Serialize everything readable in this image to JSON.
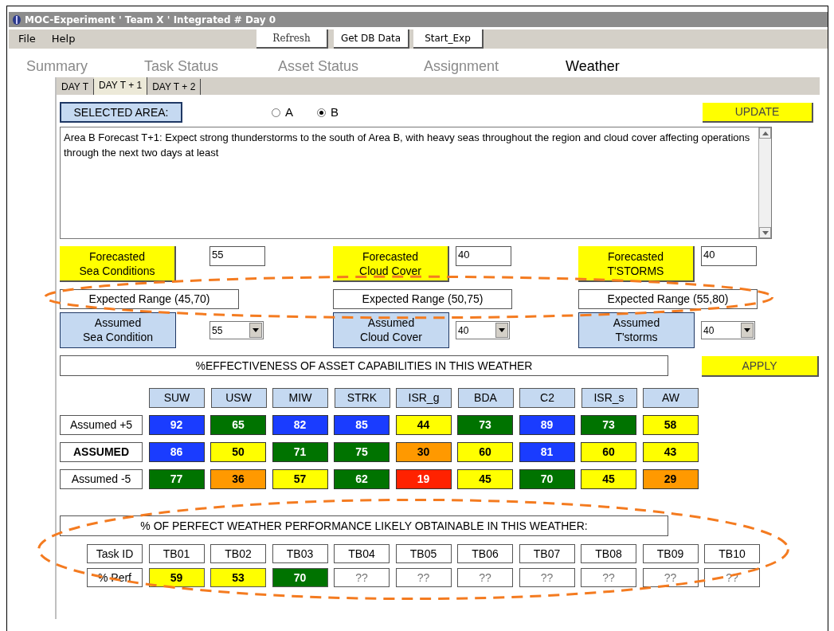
{
  "window": {
    "title": "MOC-Experiment ' Team X '  Integrated # Day 0"
  },
  "menu": [
    "File",
    "Help"
  ],
  "toolbar": {
    "buttons": [
      "Refresh",
      "Get DB Data",
      "Start_Exp"
    ]
  },
  "main_tabs": [
    {
      "label": "Summary",
      "selected": false
    },
    {
      "label": "Task Status",
      "selected": false
    },
    {
      "label": "Asset Status",
      "selected": false
    },
    {
      "label": "Assignment",
      "selected": false
    },
    {
      "label": "Weather",
      "selected": true
    }
  ],
  "day_tabs": [
    {
      "label": "DAY T",
      "selected": false
    },
    {
      "label": "DAY T + 1",
      "selected": true
    },
    {
      "label": "DAY T + 2",
      "selected": false
    }
  ],
  "selected_area": {
    "label": "SELECTED AREA:",
    "options": [
      {
        "label": "A",
        "selected": false
      },
      {
        "label": "B",
        "selected": true
      }
    ]
  },
  "update_button": "UPDATE",
  "forecast_text": "Area B Forecast T+1:  Expect strong thunderstorms to the south of Area B, with heavy seas throughout the region and cloud cover affecting operations through the next two days at least",
  "conditions": [
    {
      "forecast_label": "Forecasted\nSea Conditions",
      "forecast_value": "55",
      "range": "Expected Range (45,70)",
      "assumed_label": "Assumed\nSea Condition",
      "assumed_value": "55"
    },
    {
      "forecast_label": "Forecasted\nCloud Cover",
      "forecast_value": "40",
      "range": "Expected Range (50,75)",
      "assumed_label": "Assumed\nCloud Cover",
      "assumed_value": "40"
    },
    {
      "forecast_label": "Forecasted\nT'STORMS",
      "forecast_value": "40",
      "range": "Expected Range (55,80)",
      "assumed_label": "Assumed\nT'storms",
      "assumed_value": "40"
    }
  ],
  "effectiveness": {
    "title": "%EFFECTIVENESS OF ASSET CAPABILITIES IN THIS WEATHER",
    "apply_button": "APPLY",
    "columns": [
      "SUW",
      "USW",
      "MIW",
      "STRK",
      "ISR_g",
      "BDA",
      "C2",
      "ISR_s",
      "AW"
    ],
    "rows": [
      {
        "label": "Assumed +5",
        "kind": "offset",
        "cells": [
          {
            "value": "92",
            "color": "#1a3cff"
          },
          {
            "value": "65",
            "color": "#007300"
          },
          {
            "value": "82",
            "color": "#1a3cff"
          },
          {
            "value": "85",
            "color": "#1a3cff"
          },
          {
            "value": "44",
            "color": "#ffff00"
          },
          {
            "value": "73",
            "color": "#007300"
          },
          {
            "value": "89",
            "color": "#1a3cff"
          },
          {
            "value": "73",
            "color": "#007300"
          },
          {
            "value": "58",
            "color": "#ffff00"
          }
        ]
      },
      {
        "label": "ASSUMED",
        "kind": "baseline",
        "cells": [
          {
            "value": "86",
            "color": "#1a3cff"
          },
          {
            "value": "50",
            "color": "#ffff00"
          },
          {
            "value": "71",
            "color": "#007300"
          },
          {
            "value": "75",
            "color": "#007300"
          },
          {
            "value": "30",
            "color": "#ff9900"
          },
          {
            "value": "60",
            "color": "#ffff00"
          },
          {
            "value": "81",
            "color": "#1a3cff"
          },
          {
            "value": "60",
            "color": "#ffff00"
          },
          {
            "value": "43",
            "color": "#ffff00"
          }
        ]
      },
      {
        "label": "Assumed -5",
        "kind": "offset",
        "cells": [
          {
            "value": "77",
            "color": "#007300"
          },
          {
            "value": "36",
            "color": "#ff9900"
          },
          {
            "value": "57",
            "color": "#ffff00"
          },
          {
            "value": "62",
            "color": "#007300"
          },
          {
            "value": "19",
            "color": "#ff2200"
          },
          {
            "value": "45",
            "color": "#ffff00"
          },
          {
            "value": "70",
            "color": "#007300"
          },
          {
            "value": "45",
            "color": "#ffff00"
          },
          {
            "value": "29",
            "color": "#ff9900"
          }
        ]
      }
    ]
  },
  "performance": {
    "title": "% OF PERFECT WEATHER PERFORMANCE LIKELY OBTAINABLE IN THIS WEATHER:",
    "header_label": "Task ID",
    "row_label": "% Perf",
    "tasks": [
      {
        "id": "TB01",
        "perf": "59",
        "color": "#ffff00"
      },
      {
        "id": "TB02",
        "perf": "53",
        "color": "#ffff00"
      },
      {
        "id": "TB03",
        "perf": "70",
        "color": "#007300"
      },
      {
        "id": "TB04",
        "perf": "??",
        "color": "#ffffff"
      },
      {
        "id": "TB05",
        "perf": "??",
        "color": "#ffffff"
      },
      {
        "id": "TB06",
        "perf": "??",
        "color": "#ffffff"
      },
      {
        "id": "TB07",
        "perf": "??",
        "color": "#ffffff"
      },
      {
        "id": "TB08",
        "perf": "??",
        "color": "#ffffff"
      },
      {
        "id": "TB09",
        "perf": "??",
        "color": "#ffffff"
      },
      {
        "id": "TB10",
        "perf": "??",
        "color": "#ffffff"
      }
    ]
  }
}
